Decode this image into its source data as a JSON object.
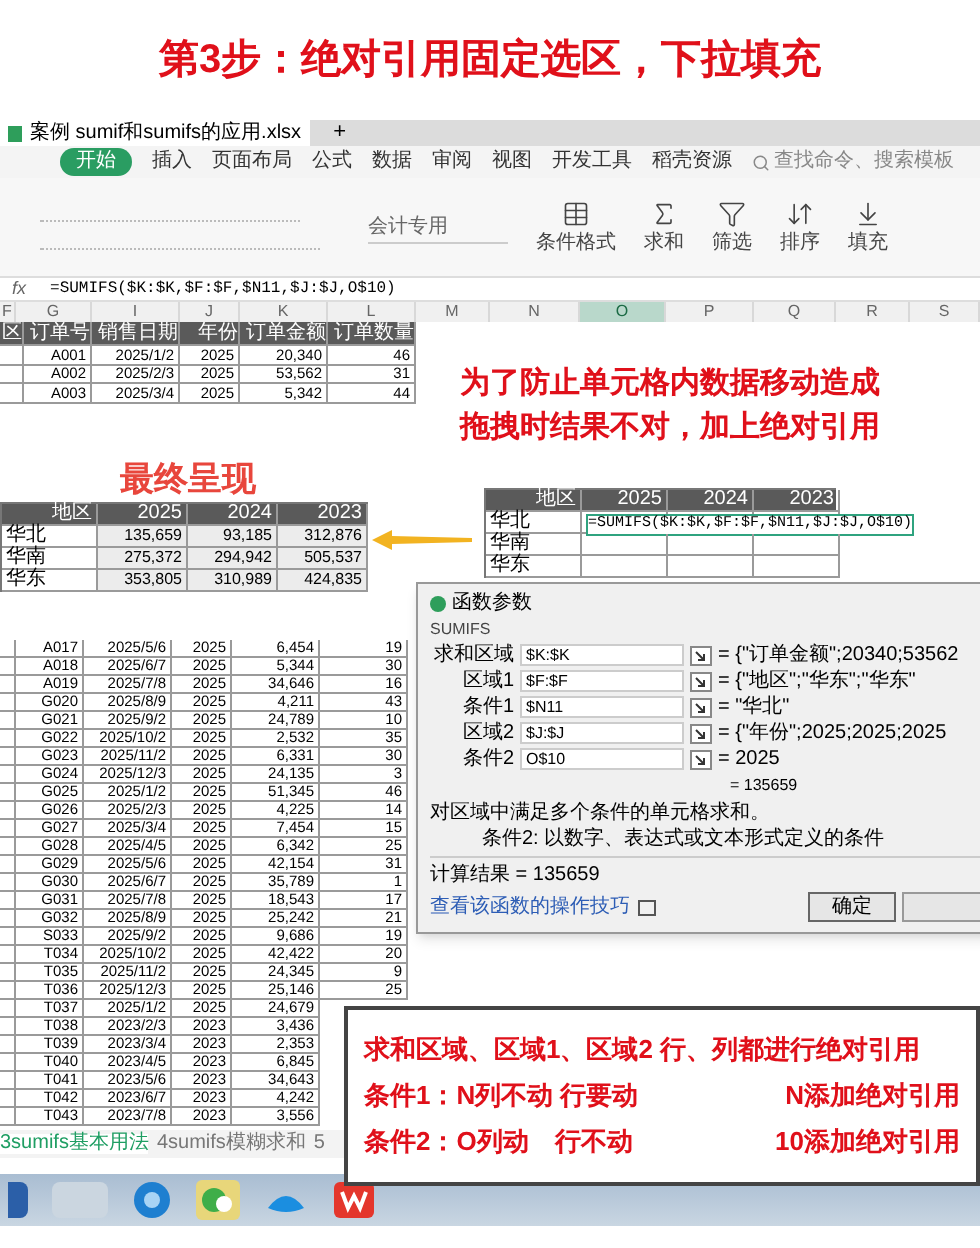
{
  "title": "第3步：绝对引用固定选区，下拉填充",
  "file_tab": {
    "name": "案例 sumif和sumifs的应用.xlsx",
    "new_tab": "+"
  },
  "menu": [
    {
      "label": "开始",
      "selected": true
    },
    {
      "label": "插入",
      "selected": false
    },
    {
      "label": "页面布局",
      "selected": false
    },
    {
      "label": "公式",
      "selected": false
    },
    {
      "label": "数据",
      "selected": false
    },
    {
      "label": "审阅",
      "selected": false
    },
    {
      "label": "视图",
      "selected": false
    },
    {
      "label": "开发工具",
      "selected": false
    },
    {
      "label": "稻壳资源",
      "selected": false
    }
  ],
  "search": {
    "placeholder": "查找命令、搜索模板"
  },
  "ribbon": {
    "number_format": "会计专用",
    "tools": [
      {
        "kind": "table",
        "label": "条件格式"
      },
      {
        "kind": "sum",
        "label": "求和"
      },
      {
        "kind": "filter",
        "label": "筛选"
      },
      {
        "kind": "sort",
        "label": "排序"
      },
      {
        "kind": "fill",
        "label": "填充"
      }
    ]
  },
  "formula_bar": {
    "label": "fx",
    "value": "=SUMIFS($K:$K,$F:$F,$N11,$J:$J,O$10)"
  },
  "column_headers": [
    {
      "label": "F",
      "selected": false
    },
    {
      "label": "G",
      "selected": false
    },
    {
      "label": "I",
      "selected": false
    },
    {
      "label": "J",
      "selected": false
    },
    {
      "label": "K",
      "selected": false
    },
    {
      "label": "L",
      "selected": false
    },
    {
      "label": "M",
      "selected": false
    },
    {
      "label": "N",
      "selected": false
    },
    {
      "label": "O",
      "selected": true
    },
    {
      "label": "P",
      "selected": false
    },
    {
      "label": "Q",
      "selected": false
    },
    {
      "label": "R",
      "selected": false
    },
    {
      "label": "S",
      "selected": false
    }
  ],
  "order_table": {
    "columns": [
      "区",
      "订单号",
      "销售日期",
      "年份",
      "订单金额",
      "订单数量"
    ],
    "rows": [
      [
        "",
        "A001",
        "2025/1/2",
        "2025",
        "20,340",
        "46"
      ],
      [
        "",
        "A002",
        "2025/2/3",
        "2025",
        "53,562",
        "31"
      ],
      [
        "",
        "A003",
        "2025/3/4",
        "2025",
        "5,342",
        "44"
      ]
    ]
  },
  "final_caption": "最终呈现",
  "final_table": {
    "columns": [
      "地区",
      "2025",
      "2024",
      "2023"
    ],
    "rows": [
      [
        "华北",
        "135,659",
        "93,185",
        "312,876"
      ],
      [
        "华南",
        "275,372",
        "294,942",
        "505,537"
      ],
      [
        "华东",
        "353,805",
        "310,989",
        "424,835"
      ]
    ]
  },
  "note": [
    "为了防止单元格内数据移动造成",
    "拖拽时结果不对，加上绝对引用"
  ],
  "entry_table": {
    "columns": [
      "地区",
      "2025",
      "2024",
      "2023"
    ],
    "rows": [
      {
        "region": "华北",
        "formula": "=SUMIFS($K:$K,$F:$F,$N11,$J:$J,O$10)"
      },
      {
        "region": "华南"
      },
      {
        "region": "华东"
      }
    ]
  },
  "detail_rows": [
    [
      "A017",
      "2025/5/6",
      "2025",
      "6,454",
      "19"
    ],
    [
      "A018",
      "2025/6/7",
      "2025",
      "5,344",
      "30"
    ],
    [
      "A019",
      "2025/7/8",
      "2025",
      "34,646",
      "16"
    ],
    [
      "G020",
      "2025/8/9",
      "2025",
      "4,211",
      "43"
    ],
    [
      "G021",
      "2025/9/2",
      "2025",
      "24,789",
      "10"
    ],
    [
      "G022",
      "2025/10/2",
      "2025",
      "2,532",
      "35"
    ],
    [
      "G023",
      "2025/11/2",
      "2025",
      "6,331",
      "30"
    ],
    [
      "G024",
      "2025/12/3",
      "2025",
      "24,135",
      "3"
    ],
    [
      "G025",
      "2025/1/2",
      "2025",
      "51,345",
      "46"
    ],
    [
      "G026",
      "2025/2/3",
      "2025",
      "4,225",
      "14"
    ],
    [
      "G027",
      "2025/3/4",
      "2025",
      "7,454",
      "15"
    ],
    [
      "G028",
      "2025/4/5",
      "2025",
      "6,342",
      "25"
    ],
    [
      "G029",
      "2025/5/6",
      "2025",
      "42,154",
      "31"
    ],
    [
      "G030",
      "2025/6/7",
      "2025",
      "35,789",
      "1"
    ],
    [
      "G031",
      "2025/7/8",
      "2025",
      "18,543",
      "17"
    ],
    [
      "G032",
      "2025/8/9",
      "2025",
      "25,242",
      "21"
    ],
    [
      "S033",
      "2025/9/2",
      "2025",
      "9,686",
      "19"
    ],
    [
      "T034",
      "2025/10/2",
      "2025",
      "42,422",
      "20"
    ],
    [
      "T035",
      "2025/11/2",
      "2025",
      "24,345",
      "9"
    ],
    [
      "T036",
      "2025/12/3",
      "2025",
      "25,146",
      "25"
    ],
    [
      "T037",
      "2025/1/2",
      "2025",
      "24,679"
    ],
    [
      "T038",
      "2023/2/3",
      "2023",
      "3,436"
    ],
    [
      "T039",
      "2023/3/4",
      "2023",
      "2,353"
    ],
    [
      "T040",
      "2023/4/5",
      "2023",
      "6,845"
    ],
    [
      "T041",
      "2023/5/6",
      "2023",
      "34,643"
    ],
    [
      "T042",
      "2023/6/7",
      "2023",
      "4,242"
    ],
    [
      "T043",
      "2023/7/8",
      "2023",
      "3,556"
    ]
  ],
  "dialog": {
    "title": "函数参数",
    "function": "SUMIFS",
    "args": [
      {
        "label": "求和区域",
        "value": "$K:$K",
        "preview": "= {\"订单金额\";20340;53562"
      },
      {
        "label": "区域1",
        "value": "$F:$F",
        "preview": "= {\"地区\";\"华东\";\"华东\""
      },
      {
        "label": "条件1",
        "value": "$N11",
        "preview": "= \"华北\""
      },
      {
        "label": "区域2",
        "value": "$J:$J",
        "preview": "= {\"年份\";2025;2025;2025"
      },
      {
        "label": "条件2",
        "value": "O$10",
        "preview": "= 2025"
      }
    ],
    "result_preview": "= 135659",
    "description": "对区域中满足多个条件的单元格求和。",
    "arg_help": "条件2:  以数字、表达式或文本形式定义的条件",
    "result": "计算结果 = 135659",
    "help_link": "查看该函数的操作技巧",
    "ok": "确定"
  },
  "sheet_tabs": [
    {
      "label": "3sumifs基本用法",
      "selected": true
    },
    {
      "label": "4sumifs模糊求和",
      "selected": false
    },
    {
      "label": "5",
      "selected": false
    }
  ],
  "callout": [
    [
      "求和区域、区域1、区域2 行、列都进行绝对引用"
    ],
    [
      "条件1：N列不动 行要动",
      "N添加绝对引用"
    ],
    [
      "条件2：O列动　行不动",
      "10添加绝对引用"
    ]
  ]
}
